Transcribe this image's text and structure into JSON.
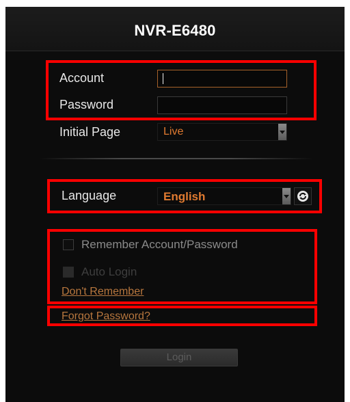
{
  "header": {
    "title": "NVR-E6480"
  },
  "form": {
    "account_label": "Account",
    "account_value": "",
    "password_label": "Password",
    "password_value": "",
    "initial_page_label": "Initial Page",
    "initial_page_value": "Live",
    "language_label": "Language",
    "language_value": "English",
    "refresh_icon": "refresh-icon"
  },
  "options": {
    "remember_label": "Remember Account/Password",
    "remember_checked": false,
    "auto_login_label": "Auto Login",
    "auto_login_checked": false,
    "auto_login_disabled": true,
    "dont_remember_link": "Don't Remember",
    "forgot_password_link": "Forgot Password?"
  },
  "actions": {
    "login_label": "Login"
  },
  "colors": {
    "accent_orange": "#e07a30",
    "link_color": "#b8773e",
    "highlight_red": "#ff0000",
    "background": "#0c0c0c"
  }
}
